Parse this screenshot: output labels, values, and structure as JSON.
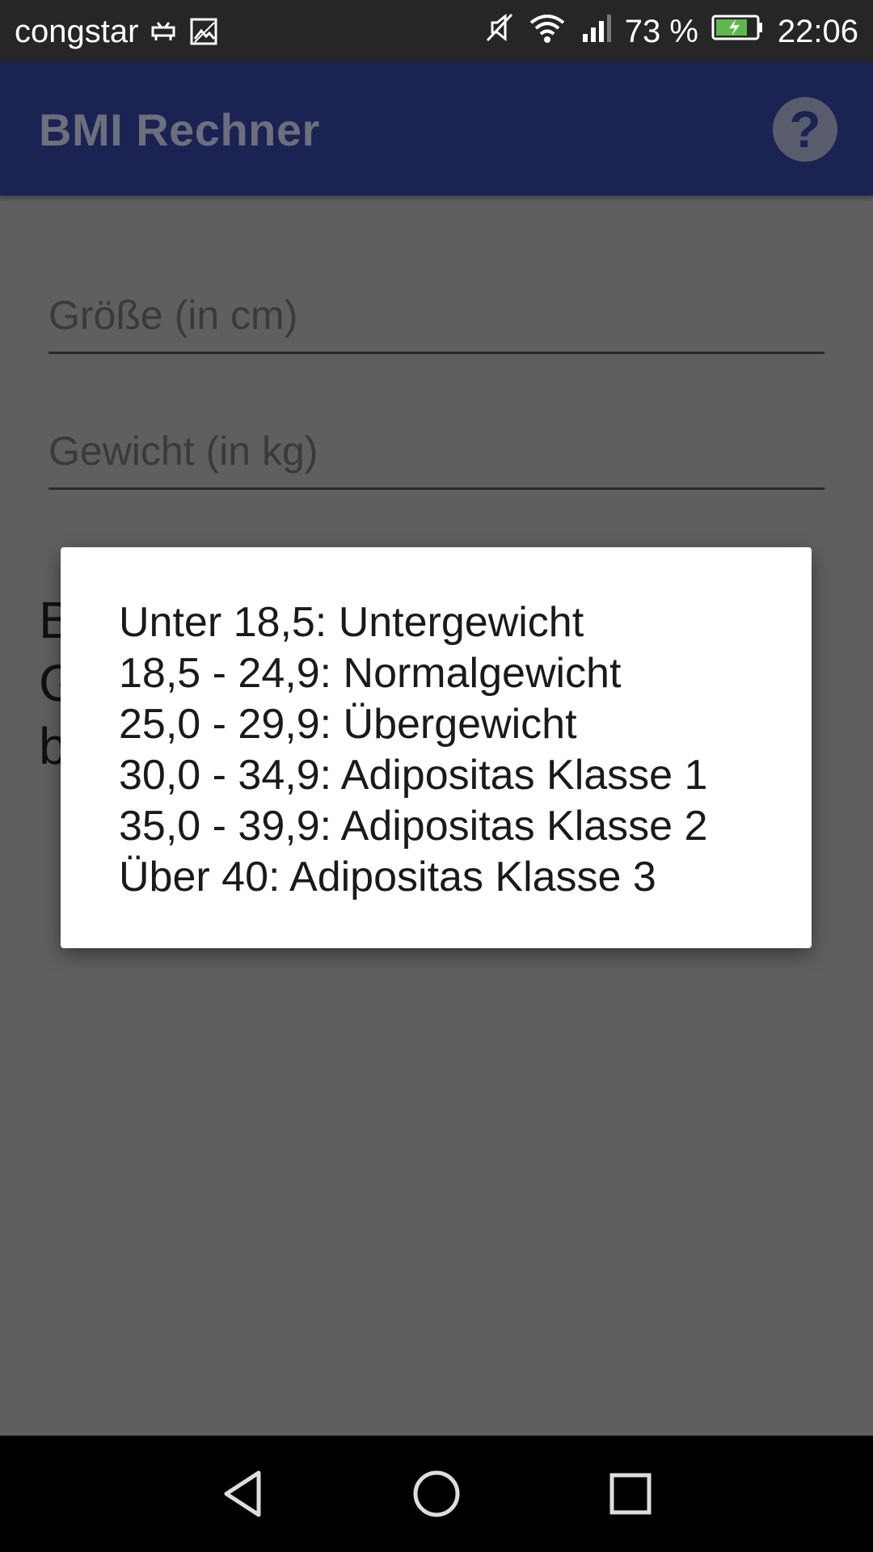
{
  "status_bar": {
    "carrier": "congstar",
    "battery_percent": "73 %",
    "time": "22:06",
    "icons": [
      "android-debug-icon",
      "image-icon",
      "mute-icon",
      "wifi-icon",
      "signal-icon",
      "battery-charging-icon"
    ]
  },
  "app_bar": {
    "title": "BMI Rechner",
    "help_label": "?"
  },
  "form": {
    "height_placeholder": "Größe (in cm)",
    "weight_placeholder": "Gewicht (in kg)",
    "result_partial": [
      "B",
      "G",
      "b"
    ]
  },
  "dialog": {
    "lines": [
      "Unter 18,5: Untergewicht",
      "18,5 - 24,9: Normalgewicht",
      "25,0 - 29,9: Übergewicht",
      "30,0 - 34,9: Adipositas Klasse 1",
      "35,0 - 39,9: Adipositas Klasse 2",
      "Über 40: Adipositas Klasse 3"
    ]
  },
  "nav_bar": {
    "icons": [
      "back-icon",
      "home-icon",
      "recent-apps-icon"
    ]
  },
  "colors": {
    "app_bar": "#1b2353",
    "scrim": "#5f5f5f",
    "dialog_bg": "#ffffff"
  }
}
